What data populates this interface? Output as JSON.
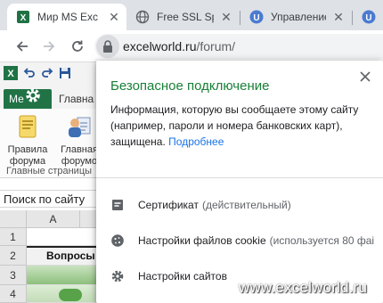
{
  "browser": {
    "tabs": [
      {
        "title": "Мир MS Exc",
        "favicon": "excel-icon",
        "active": true
      },
      {
        "title": "Free SSL Spa",
        "favicon": "globe-icon",
        "active": false
      },
      {
        "title": "Управление",
        "favicon": "u-badge-icon",
        "active": false
      },
      {
        "title": "",
        "favicon": "u-badge-icon",
        "active": false
      }
    ],
    "url": {
      "host": "excelworld.ru",
      "path": "/forum/"
    }
  },
  "excel": {
    "menu_tab": "Ме",
    "ribbon_tab_2": "Главна",
    "buttons": [
      {
        "label_1": "Правила",
        "label_2": "форума"
      },
      {
        "label_1": "Главная",
        "label_2": "форумо"
      }
    ],
    "group_label": "Главные страницы",
    "search_placeholder": "Поиск по сайту",
    "column_a": "A",
    "rows": [
      "1",
      "2",
      "3",
      "4"
    ],
    "row2_text": "Вопросы"
  },
  "popup": {
    "title": "Безопасное подключение",
    "body": "Информация, которую вы сообщаете этому сайту (например, пароли и номера банковских карт), защищена.",
    "link": "Подробнее",
    "certificate": {
      "label": "Сертификат",
      "status": "(действительный)"
    },
    "cookies": {
      "label": "Настройки файлов cookie",
      "status": "(используется 80 фаі"
    },
    "site_settings": {
      "label": "Настройки сайтов"
    }
  },
  "watermark": "www.excelworld.ru",
  "colors": {
    "secure_green": "#188038",
    "link_blue": "#1a73e8",
    "excel_green": "#217346"
  }
}
